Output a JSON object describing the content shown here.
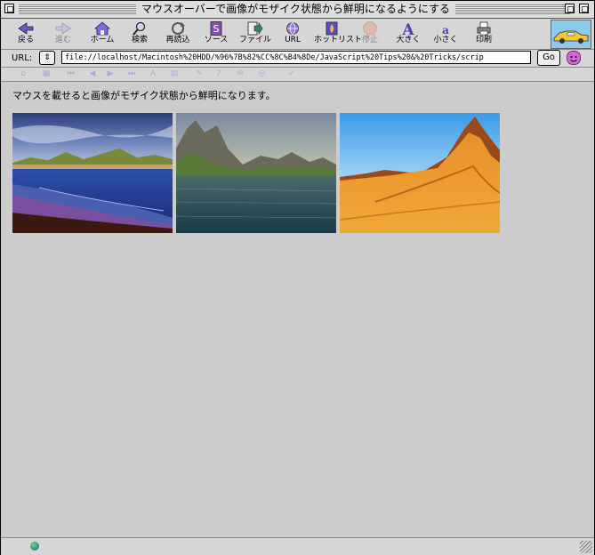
{
  "window": {
    "title": "マウスオーバーで画像がモザイク状態から鮮明になるようにする"
  },
  "toolbar": {
    "buttons": [
      {
        "label": "戻る",
        "icon": "back-arrow-icon",
        "enabled": true
      },
      {
        "label": "進む",
        "icon": "forward-arrow-icon",
        "enabled": false
      },
      {
        "label": "ホーム",
        "icon": "home-icon",
        "enabled": true
      },
      {
        "label": "検索",
        "icon": "search-icon",
        "enabled": true
      },
      {
        "label": "再読込",
        "icon": "reload-icon",
        "enabled": true
      },
      {
        "label": "ソース",
        "icon": "source-icon",
        "enabled": true
      },
      {
        "label": "ファイル",
        "icon": "file-icon",
        "enabled": true
      },
      {
        "label": "URL",
        "icon": "url-globe-icon",
        "enabled": true
      },
      {
        "label": "ホットリスト",
        "icon": "hotlist-icon",
        "enabled": true
      },
      {
        "label": "停止",
        "icon": "stop-icon",
        "enabled": false
      },
      {
        "label": "大きく",
        "icon": "text-larger-icon",
        "enabled": true
      },
      {
        "label": "小さく",
        "icon": "text-smaller-icon",
        "enabled": true
      },
      {
        "label": "印刷",
        "icon": "print-icon",
        "enabled": true
      }
    ]
  },
  "urlbar": {
    "label": "URL:",
    "selector_glyph": "⇕",
    "value": "file://localhost/Macintosh%20HDD/%96%7B%82%CC%8C%B4%8De/JavaScript%20Tips%20&%20Tricks/scrip",
    "go_label": "Go"
  },
  "content": {
    "paragraph": "マウスを載せると画像がモザイク状態から鮮明になります。",
    "images": [
      {
        "name": "seascape-beach-photo"
      },
      {
        "name": "mountain-lake-photo"
      },
      {
        "name": "desert-mountain-photo"
      }
    ]
  },
  "colors": {
    "background": "#cccccc",
    "sky_blue": "#8ec9ea",
    "disabled_icon": "#b0a8d8"
  }
}
